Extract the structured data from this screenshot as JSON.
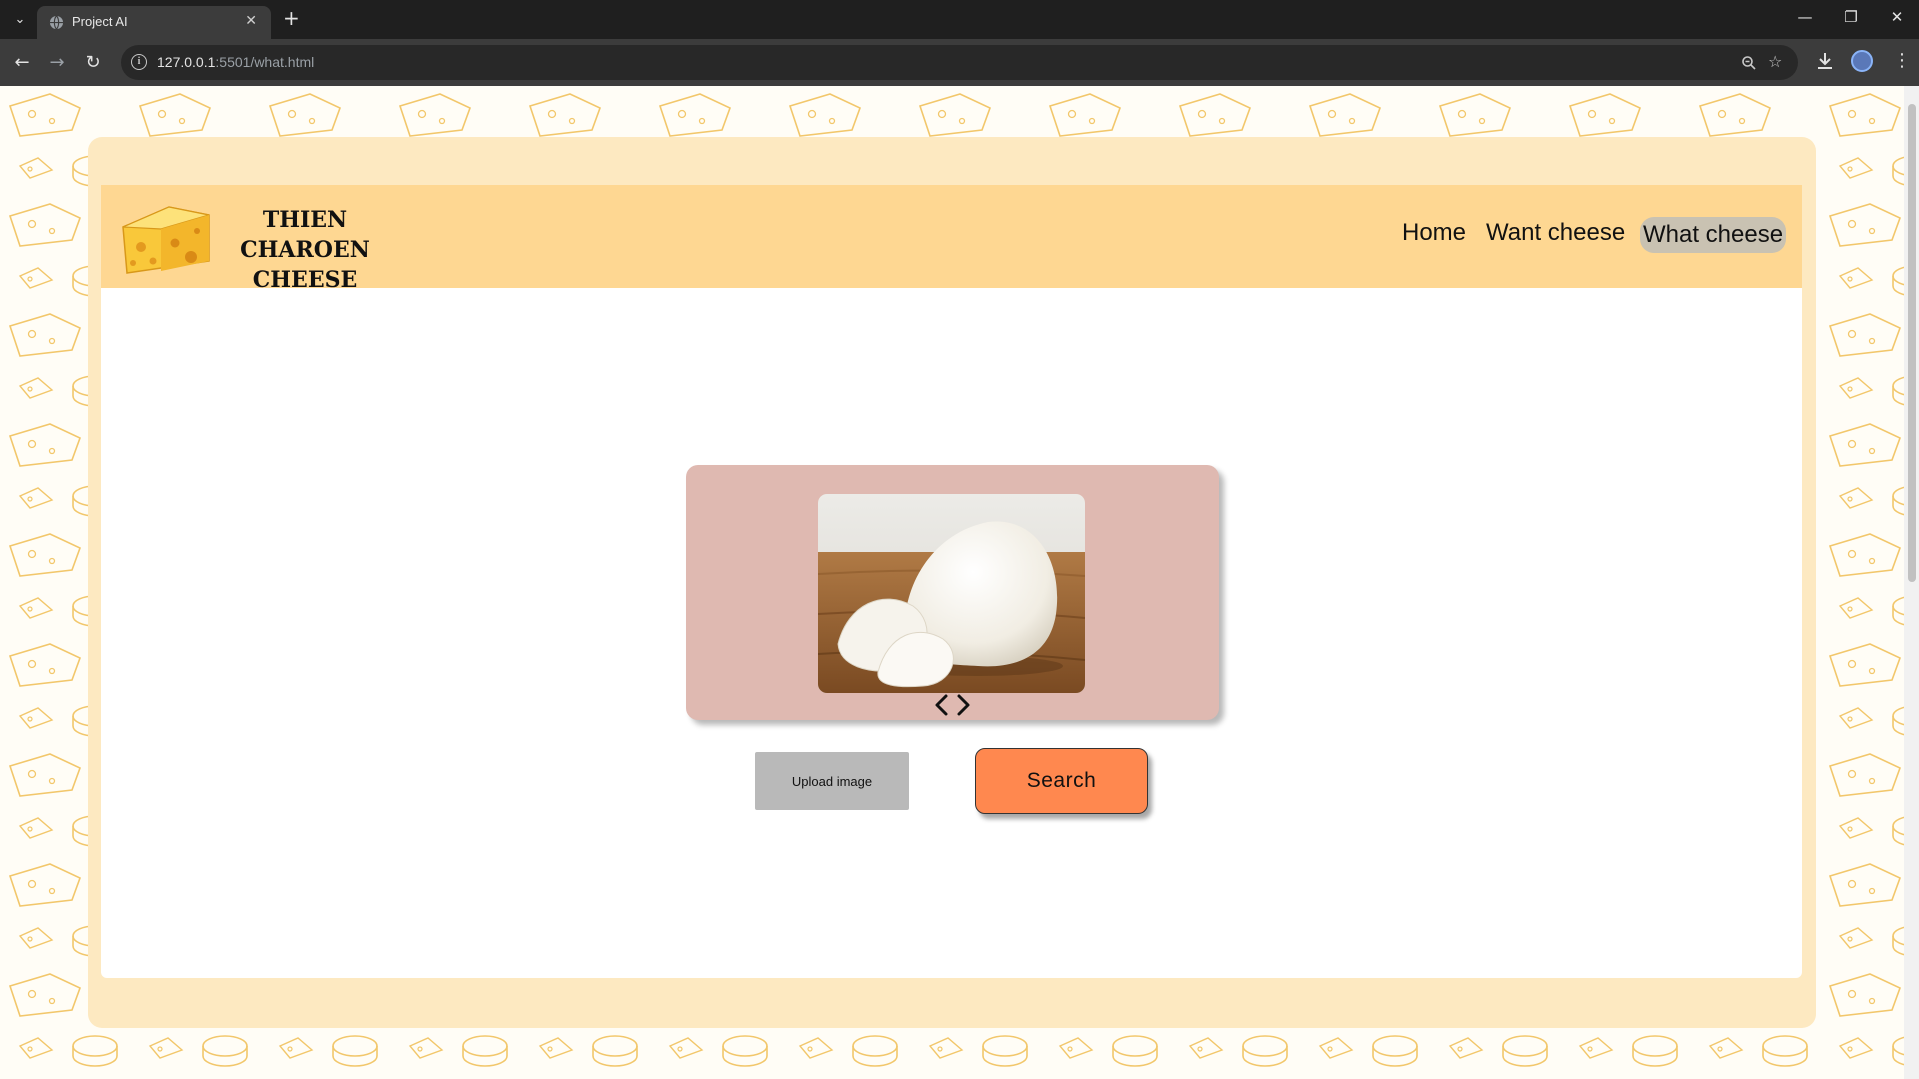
{
  "browser": {
    "tab_title": "Project AI",
    "tab_close": "✕",
    "new_tab": "+",
    "url_host": "127.0.0.1",
    "url_path": ":5501/what.html",
    "icons": [
      "tab-search-icon",
      "favicon-globe-icon",
      "close-icon",
      "new-tab-icon",
      "back-icon",
      "forward-icon",
      "reload-icon",
      "site-info-icon",
      "zoom-icon",
      "bookmark-star-icon",
      "download-icon",
      "profile-avatar",
      "menu-kebab-icon",
      "minimize-icon",
      "restore-icon",
      "close-window-icon"
    ]
  },
  "site": {
    "brand_line1": "THIEN CHAROEN",
    "brand_line2": "CHEESE",
    "nav": {
      "home": "Home",
      "want": "Want cheese",
      "what": "What cheese"
    },
    "active_nav": "What cheese"
  },
  "main": {
    "upload_label": "Upload image",
    "search_label": "Search"
  },
  "colors": {
    "page_background": "#fffdf6",
    "outer_card": "#fde9c1",
    "header_bar": "#fed792",
    "carousel_panel": "#dfb9b1",
    "upload_button": "#b9b9b9",
    "search_button": "#ff884f",
    "active_nav_pill": "#c9c2b2",
    "pattern_stroke": "#f2c76b"
  }
}
